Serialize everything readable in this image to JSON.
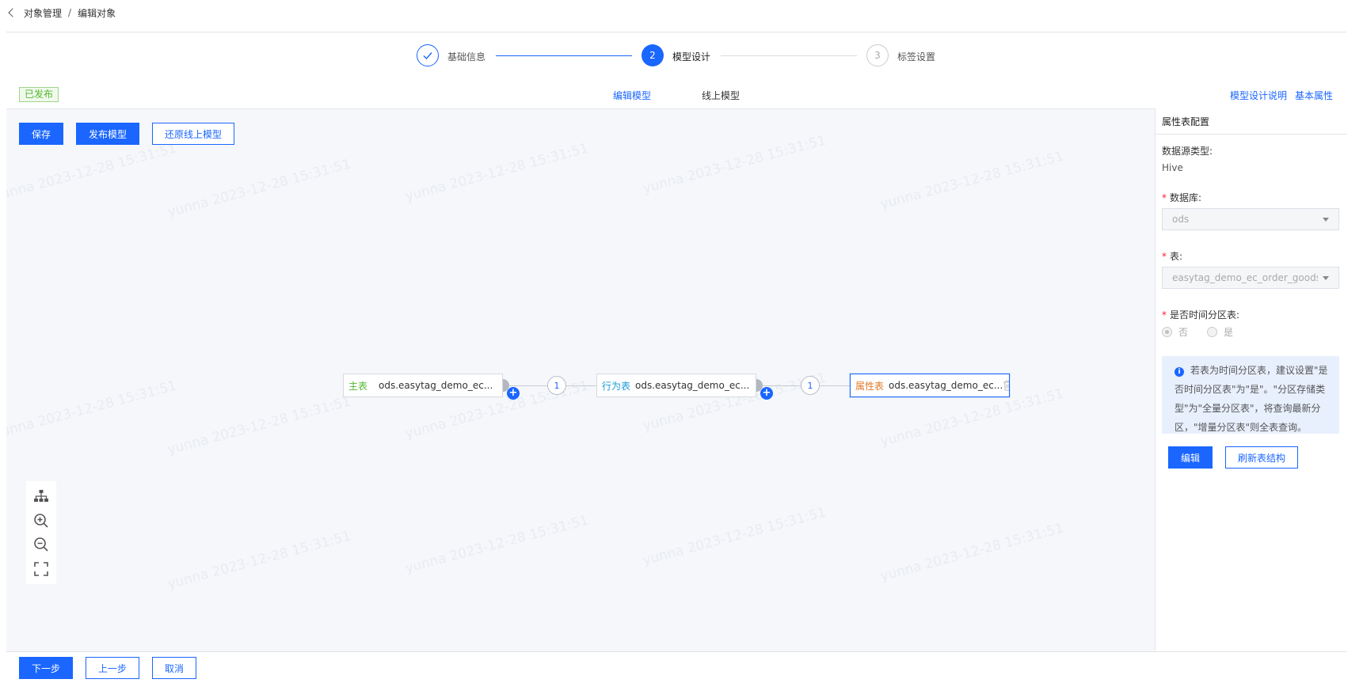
{
  "breadcrumb": {
    "parent": "对象管理",
    "separator": "/",
    "current": "编辑对象"
  },
  "steps": [
    {
      "label": "基础信息",
      "state": "done",
      "number": ""
    },
    {
      "label": "模型设计",
      "state": "active",
      "number": "2"
    },
    {
      "label": "标签设置",
      "state": "wait",
      "number": "3"
    }
  ],
  "status_badge": "已发布",
  "tabs": [
    {
      "label": "编辑模型",
      "active": true
    },
    {
      "label": "线上模型",
      "active": false
    }
  ],
  "top_links": {
    "design_help": "模型设计说明",
    "basic_props": "基本属性"
  },
  "toolbar": {
    "save": "保存",
    "publish": "发布模型",
    "restore": "还原线上模型"
  },
  "watermark": "yunna 2023-12-28 15:31:51",
  "nodes": [
    {
      "type_label": "主表",
      "table": "ods.easytag_demo_ec..."
    },
    {
      "type_label": "行为表",
      "table": "ods.easytag_demo_ec..."
    },
    {
      "type_label": "属性表",
      "table": "ods.easytag_demo_ec..."
    }
  ],
  "relations": [
    "1",
    "1"
  ],
  "panel": {
    "title": "属性表配置",
    "datasource_label": "数据源类型:",
    "datasource_value": "Hive",
    "database_label": "数据库:",
    "database_value": "ods",
    "table_label": "表:",
    "table_value": "easytag_demo_ec_order_goods_d",
    "partition_label": "是否时间分区表:",
    "partition_options": [
      "否",
      "是"
    ],
    "partition_selected": "否",
    "notice": "若表为时间分区表，建议设置\"是否时间分区表\"为\"是\"。\"分区存储类型\"为\"全量分区表\"，将查询最新分区，\"增量分区表\"则全表查询。",
    "edit_button": "编辑",
    "refresh_button": "刷新表结构",
    "required_mark": "*"
  },
  "footer": {
    "next": "下一步",
    "prev": "上一步",
    "cancel": "取消"
  },
  "colors": {
    "primary": "#1a66ff",
    "main_table": "#52b830",
    "action_table": "#1a9bd8",
    "attr_table": "#e07a2a"
  },
  "icons": [
    "hierarchy-icon",
    "zoom-in-icon",
    "zoom-out-icon",
    "fit-screen-icon",
    "delete-icon",
    "check-icon",
    "info-icon"
  ]
}
